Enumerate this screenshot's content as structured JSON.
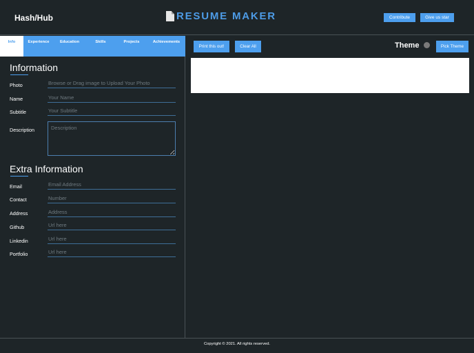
{
  "header": {
    "brand": "Hash/Hub",
    "app_title": "RESUME MAKER",
    "app_icon": "document-icon",
    "buttons": {
      "contribute": "Contribute",
      "star": "Give us star"
    }
  },
  "tabs": [
    {
      "label": "Info",
      "active": true
    },
    {
      "label": "Experience",
      "active": false
    },
    {
      "label": "Education",
      "active": false
    },
    {
      "label": "Skills",
      "active": false
    },
    {
      "label": "Projects",
      "active": false
    },
    {
      "label": "Achievements",
      "active": false
    }
  ],
  "information": {
    "title": "Information",
    "fields": {
      "photo": {
        "label": "Photo",
        "placeholder": "Browse or Drag image to Upload Your Photo"
      },
      "name": {
        "label": "Name",
        "placeholder": "Your Name"
      },
      "subtitle": {
        "label": "Subtitle",
        "placeholder": "Your Subtitle"
      },
      "description": {
        "label": "Description",
        "placeholder": "Description"
      }
    }
  },
  "extra": {
    "title": "Extra Information",
    "fields": {
      "email": {
        "label": "Email",
        "placeholder": "Email Address"
      },
      "contact": {
        "label": "Contact",
        "placeholder": "Number"
      },
      "address": {
        "label": "Address",
        "placeholder": "Address"
      },
      "github": {
        "label": "Github",
        "placeholder": "Url here"
      },
      "linkedin": {
        "label": "Linkedin",
        "placeholder": "Url here"
      },
      "portfolio": {
        "label": "Portfolio",
        "placeholder": "Url here"
      }
    }
  },
  "preview_toolbar": {
    "print": "Print this out!",
    "clear": "Clear All",
    "theme_label": "Theme",
    "theme_color": "#7a7a7a",
    "pick_theme": "Pick Theme"
  },
  "colors": {
    "accent": "#4d9fee",
    "background": "#1e2528",
    "title_blue": "#4d9be6"
  },
  "footer": {
    "copyright": "Copyright © 2021. All rights reserved."
  }
}
